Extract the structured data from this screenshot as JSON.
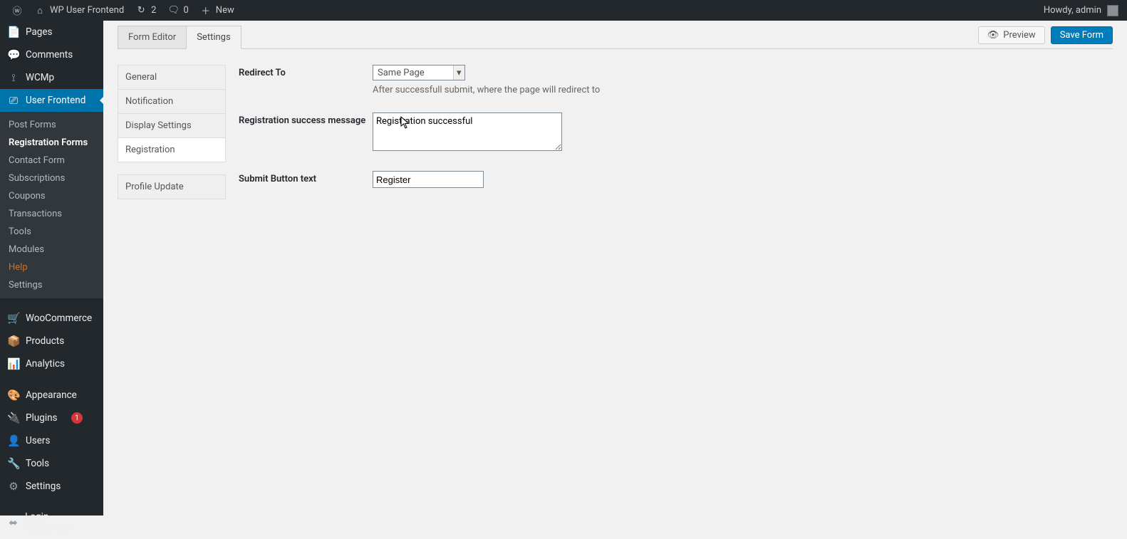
{
  "adminbar": {
    "site_name": "WP User Frontend",
    "updates_count": "2",
    "comments_count": "0",
    "new_label": "New",
    "howdy": "Howdy, admin"
  },
  "admin_menu": {
    "items": [
      {
        "icon": "📄",
        "label": "Pages"
      },
      {
        "icon": "💬",
        "label": "Comments"
      },
      {
        "icon": "⟟",
        "label": "WCMp"
      },
      {
        "icon": "⎚",
        "label": "User Frontend",
        "current": true
      },
      {
        "icon": "🛒",
        "label": "WooCommerce"
      },
      {
        "icon": "📦",
        "label": "Products"
      },
      {
        "icon": "📊",
        "label": "Analytics"
      },
      {
        "icon": "🎨",
        "label": "Appearance"
      },
      {
        "icon": "🔌",
        "label": "Plugins",
        "badge": "1"
      },
      {
        "icon": "👤",
        "label": "Users"
      },
      {
        "icon": "🔧",
        "label": "Tools"
      },
      {
        "icon": "⚙",
        "label": "Settings"
      },
      {
        "icon": "⬌",
        "label": "Login Customizer"
      }
    ],
    "submenu": [
      {
        "label": "Post Forms"
      },
      {
        "label": "Registration Forms",
        "active": true
      },
      {
        "label": "Contact Form"
      },
      {
        "label": "Subscriptions"
      },
      {
        "label": "Coupons"
      },
      {
        "label": "Transactions"
      },
      {
        "label": "Tools"
      },
      {
        "label": "Modules"
      },
      {
        "label": "Help",
        "help": true
      },
      {
        "label": "Settings"
      }
    ]
  },
  "tabs": {
    "form_editor": "Form Editor",
    "settings": "Settings"
  },
  "actions": {
    "preview": "Preview",
    "save": "Save Form"
  },
  "vtabs": {
    "general": "General",
    "notification": "Notification",
    "display": "Display Settings",
    "registration": "Registration",
    "profile": "Profile Update"
  },
  "form": {
    "redirect_label": "Redirect To",
    "redirect_value": "Same Page",
    "redirect_help": "After successfull submit, where the page will redirect to",
    "success_label": "Registration success message",
    "success_value": "Registration successful",
    "submit_label": "Submit Button text",
    "submit_value": "Register"
  }
}
